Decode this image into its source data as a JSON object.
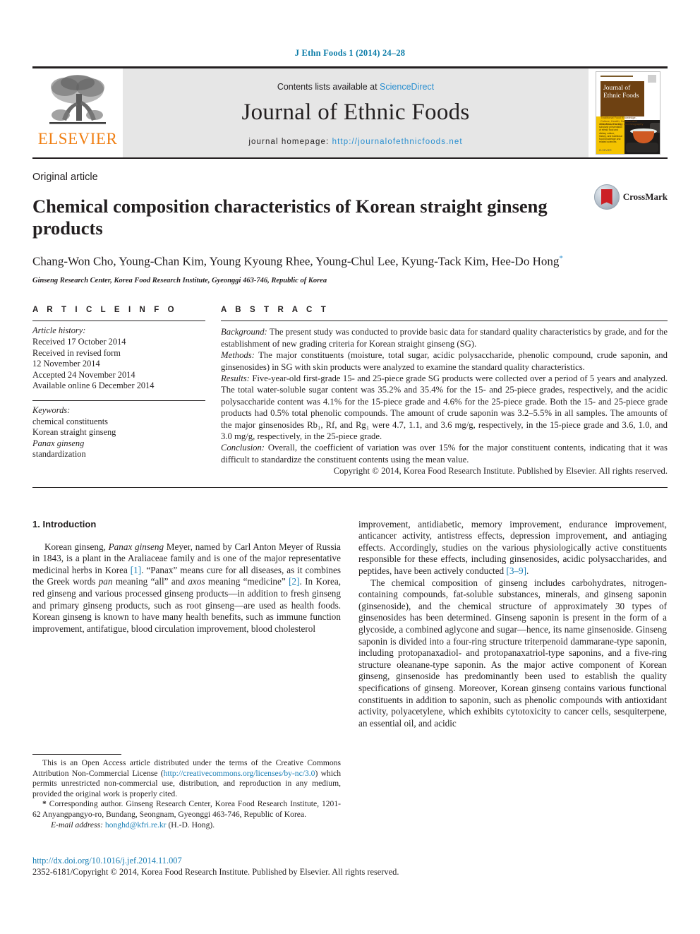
{
  "running_head": "J Ethn Foods 1 (2014) 24–28",
  "masthead": {
    "publisher_logo_text": "ELSEVIER",
    "publisher_logo_icon": "elsevier-tree-icon",
    "contents_prefix": "Contents lists available at ",
    "contents_link": "ScienceDirect",
    "journal_title": "Journal of Ethnic Foods",
    "homepage_prefix": "journal homepage: ",
    "homepage_url": "http://journalofethnicfoods.net",
    "cover": {
      "title_line1": "Journal of",
      "title_line2": "Ethnic Foods",
      "subtitle": "Traditional Food Knowledge, Culture, Health, Nutrition and Dietetics, Ecology and Geography",
      "yellow_text": "Aims:\nA forum for the scholarly presentation of ethnic food and dietary culture, history, and traditional food knowledge and related sciences",
      "footer": "ELSEVIER"
    }
  },
  "article": {
    "type": "Original article",
    "title": "Chemical composition characteristics of Korean straight ginseng products",
    "authors": "Chang-Won Cho, Young-Chan Kim, Young Kyoung Rhee, Young-Chul Lee, Kyung-Tack Kim, Hee-Do Hong",
    "corresponding_marker": "*",
    "affiliation": "Ginseng Research Center, Korea Food Research Institute, Gyeonggi 463-746, Republic of Korea",
    "crossmark_label": "CrossMark"
  },
  "article_info": {
    "heading": "A R T I C L E   I N F O",
    "history_label": "Article history:",
    "history": [
      "Received 17 October 2014",
      "Received in revised form",
      "12 November 2014",
      "Accepted 24 November 2014",
      "Available online 6 December 2014"
    ],
    "keywords_label": "Keywords:",
    "keywords": [
      "chemical constituents",
      "Korean straight ginseng",
      "Panax ginseng",
      "standardization"
    ],
    "keyword_italic_index": 2
  },
  "abstract": {
    "heading": "A B S T R A C T",
    "sections": [
      {
        "label": "Background:",
        "text": " The present study was conducted to provide basic data for standard quality characteristics by grade, and for the establishment of new grading criteria for Korean straight ginseng (SG)."
      },
      {
        "label": "Methods:",
        "text": " The major constituents (moisture, total sugar, acidic polysaccharide, phenolic compound, crude saponin, and ginsenosides) in SG with skin products were analyzed to examine the standard quality characteristics."
      },
      {
        "label": "Results:",
        "text": " Five-year-old first-grade 15- and 25-piece grade SG products were collected over a period of 5 years and analyzed. The total water-soluble sugar content was 35.2% and 35.4% for the 15- and 25-piece grades, respectively, and the acidic polysaccharide content was 4.1% for the 15-piece grade and 4.6% for the 25-piece grade. Both the 15- and 25-piece grade products had 0.5% total phenolic compounds. The amount of crude saponin was 3.2–5.5% in all samples. The amounts of the major ginsenosides Rb₁, Rf, and Rg₁ were 4.7, 1.1, and 3.6 mg/g, respectively, in the 15-piece grade and 3.6, 1.0, and 3.0 mg/g, respectively, in the 25-piece grade."
      },
      {
        "label": "Conclusion:",
        "text": " Overall, the coefficient of variation was over 15% for the major constituent contents, indicating that it was difficult to standardize the constituent contents using the mean value."
      }
    ],
    "copyright": "Copyright © 2014, Korea Food Research Institute. Published by Elsevier. All rights reserved."
  },
  "introduction": {
    "heading": "1.  Introduction",
    "left_paragraphs": [
      "Korean ginseng, <i>Panax ginseng</i> Meyer, named by Carl Anton Meyer of Russia in 1843, is a plant in the Araliaceae family and is one of the major representative medicinal herbs in Korea <span class=\"ref\">[1]</span>. “Panax” means cure for all diseases, as it combines the Greek words <i>pan</i> meaning “all” and <i>axos</i> meaning “medicine” <span class=\"ref\">[2]</span>. In Korea, red ginseng and various processed ginseng products—in addition to fresh ginseng and primary ginseng products, such as root ginseng—are used as health foods. Korean ginseng is known to have many health benefits, such as immune function improvement, antifatigue, blood circulation improvement, blood cholesterol"
    ],
    "right_paragraphs": [
      "improvement, antidiabetic, memory improvement, endurance improvement, anticancer activity, antistress effects, depression improvement, and antiaging effects. Accordingly, studies on the various physiologically active constituents responsible for these effects, including ginsenosides, acidic polysaccharides, and peptides, have been actively conducted <span class=\"ref\">[3–9]</span>.",
      "The chemical composition of ginseng includes carbohydrates, nitrogen-containing compounds, fat-soluble substances, minerals, and ginseng saponin (ginsenoside), and the chemical structure of approximately 30 types of ginsenosides has been determined. Ginseng saponin is present in the form of a glycoside, a combined aglycone and sugar—hence, its name ginsenoside. Ginseng saponin is divided into a four-ring structure triterpenoid dammarane-type saponin, including protopanaxadiol- and protopanaxatriol-type saponins, and a five-ring structure oleanane-type saponin. As the major active component of Korean ginseng, ginsenoside has predominantly been used to establish the quality specifications of ginseng. Moreover, Korean ginseng contains various functional constituents in addition to saponin, such as phenolic compounds with antioxidant activity, polyacetylene, which exhibits cytotoxicity to cancer cells, sesquiterpene, an essential oil, and acidic"
    ]
  },
  "footnotes": {
    "license": "This is an Open Access article distributed under the terms of the Creative Commons Attribution Non-Commercial License (<span class=\"link\">http://creativecommons.org/licenses/by-nc/3.0</span>) which permits unrestricted non-commercial use, distribution, and reproduction in any medium, provided the original work is properly cited.",
    "corresponding": "<b>*</b> Corresponding author. Ginseng Research Center, Korea Food Research Institute, 1201-62 Anyangpangyo-ro, Bundang, Seongnam, Gyeonggi 463-746, Republic of Korea.",
    "email": "<i>E-mail address:</i> <span class=\"link\">honghd@kfri.re.kr</span> (H.-D. Hong)."
  },
  "page_footer": {
    "doi": "http://dx.doi.org/10.1016/j.jef.2014.11.007",
    "issn_copyright": "2352-6181/Copyright © 2014, Korea Food Research Institute. Published by Elsevier. All rights reserved."
  },
  "colors": {
    "link_blue": "#1a7fb5",
    "sciencedirect_blue": "#2a8fd0",
    "elsevier_orange": "#f07f13",
    "masthead_gray": "#e6e6e6",
    "text_black": "#231f20"
  }
}
